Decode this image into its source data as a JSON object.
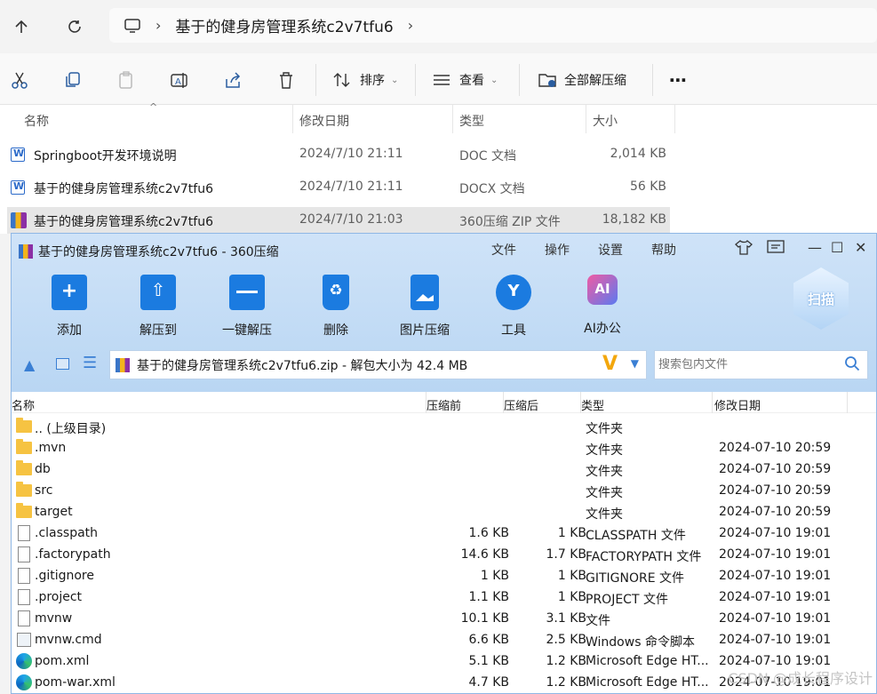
{
  "explorer": {
    "breadcrumb": [
      "基于的健身房管理系统c2v7tfu6"
    ],
    "toolbar": {
      "sort_label": "排序",
      "view_label": "查看",
      "extract_all_label": "全部解压缩"
    },
    "columns": [
      "名称",
      "修改日期",
      "类型",
      "大小"
    ],
    "files": [
      {
        "name": "Springboot开发环境说明",
        "date": "2024/7/10 21:11",
        "type": "DOC 文档",
        "size": "2,014 KB",
        "icon": "word-icon"
      },
      {
        "name": "基于的健身房管理系统c2v7tfu6",
        "date": "2024/7/10 21:11",
        "type": "DOCX 文档",
        "size": "56 KB",
        "icon": "word-icon"
      },
      {
        "name": "基于的健身房管理系统c2v7tfu6",
        "date": "2024/7/10 21:03",
        "type": "360压缩 ZIP 文件",
        "size": "18,182 KB",
        "icon": "zip-icon",
        "selected": true
      }
    ]
  },
  "zip": {
    "title": "基于的健身房管理系统c2v7tfu6 - 360压缩",
    "menu": [
      "文件",
      "操作",
      "设置",
      "帮助"
    ],
    "tools": [
      "添加",
      "解压到",
      "一键解压",
      "删除",
      "图片压缩",
      "工具",
      "AI办公"
    ],
    "scan_label": "扫描",
    "path": "基于的健身房管理系统c2v7tfu6.zip - 解包大小为 42.4 MB",
    "search_placeholder": "搜索包内文件",
    "columns": [
      "名称",
      "压缩前",
      "压缩后",
      "类型",
      "修改日期"
    ],
    "rows": [
      {
        "name": ".. (上级目录)",
        "before": "",
        "after": "",
        "type": "文件夹",
        "date": "",
        "icon": "folder-icon"
      },
      {
        "name": ".mvn",
        "before": "",
        "after": "",
        "type": "文件夹",
        "date": "2024-07-10 20:59",
        "icon": "folder-icon"
      },
      {
        "name": "db",
        "before": "",
        "after": "",
        "type": "文件夹",
        "date": "2024-07-10 20:59",
        "icon": "folder-icon"
      },
      {
        "name": "src",
        "before": "",
        "after": "",
        "type": "文件夹",
        "date": "2024-07-10 20:59",
        "icon": "folder-icon"
      },
      {
        "name": "target",
        "before": "",
        "after": "",
        "type": "文件夹",
        "date": "2024-07-10 20:59",
        "icon": "folder-icon"
      },
      {
        "name": ".classpath",
        "before": "1.6 KB",
        "after": "1 KB",
        "type": "CLASSPATH 文件",
        "date": "2024-07-10 19:01",
        "icon": "file-icon"
      },
      {
        "name": ".factorypath",
        "before": "14.6 KB",
        "after": "1.7 KB",
        "type": "FACTORYPATH 文件",
        "date": "2024-07-10 19:01",
        "icon": "file-icon"
      },
      {
        "name": ".gitignore",
        "before": "1 KB",
        "after": "1 KB",
        "type": "GITIGNORE 文件",
        "date": "2024-07-10 19:01",
        "icon": "file-icon"
      },
      {
        "name": ".project",
        "before": "1.1 KB",
        "after": "1 KB",
        "type": "PROJECT 文件",
        "date": "2024-07-10 19:01",
        "icon": "file-icon"
      },
      {
        "name": "mvnw",
        "before": "10.1 KB",
        "after": "3.1 KB",
        "type": "文件",
        "date": "2024-07-10 19:01",
        "icon": "file-icon"
      },
      {
        "name": "mvnw.cmd",
        "before": "6.6 KB",
        "after": "2.5 KB",
        "type": "Windows 命令脚本",
        "date": "2024-07-10 19:01",
        "icon": "cmd-icon"
      },
      {
        "name": "pom.xml",
        "before": "5.1 KB",
        "after": "1.2 KB",
        "type": "Microsoft Edge HT...",
        "date": "2024-07-10 19:01",
        "icon": "edge-icon"
      },
      {
        "name": "pom-war.xml",
        "before": "4.7 KB",
        "after": "1.2 KB",
        "type": "Microsoft Edge HT...",
        "date": "2024-07-10 19:01",
        "icon": "edge-icon"
      }
    ]
  },
  "watermark": "CSDN @成长程序设计"
}
